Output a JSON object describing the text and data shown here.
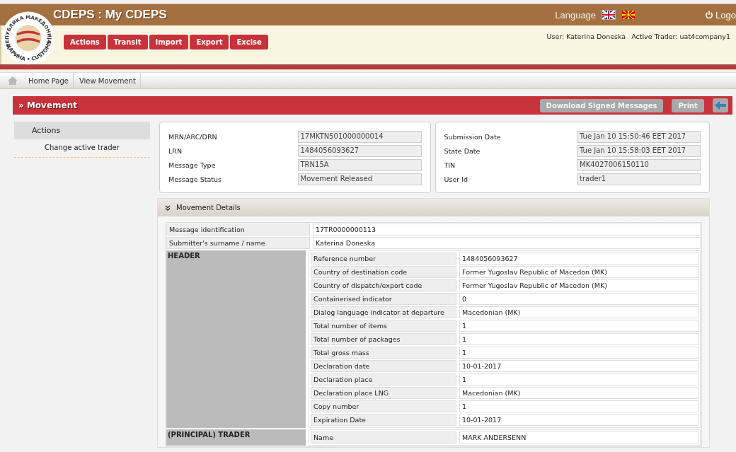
{
  "header": {
    "title": "CDEPS : My CDEPS",
    "logo_text": [
      "РЕПУБЛИКА МАКЕДОНИЈА",
      "ЦАРИНА • CUSTOMS"
    ],
    "language_label": "Language",
    "languages": [
      {
        "kind": "uk",
        "selected": true
      },
      {
        "kind": "mk",
        "selected": false
      }
    ],
    "logout": "Logo",
    "user": "User: Katerina Doneska",
    "active_trader": "Active Trader: uat4company1"
  },
  "nav": [
    "Actions",
    "Transit",
    "Import",
    "Export",
    "Excise"
  ],
  "breadcrumb": [
    "Home Page",
    "View Movement"
  ],
  "page_title": "» Movement",
  "toolbar": [
    "Download Signed Messages",
    "Print"
  ],
  "sidebar": {
    "heading": "Actions",
    "items": [
      "Change active trader"
    ]
  },
  "summary_left": [
    {
      "label": "MRN/ARC/DRN",
      "value": "17MKTN501000000014"
    },
    {
      "label": "LRN",
      "value": "1484056093627"
    },
    {
      "label": "Message Type",
      "value": "TRN15A"
    },
    {
      "label": "Message Status",
      "value": "Movement Released"
    }
  ],
  "summary_right": [
    {
      "label": "Submission Date",
      "value": "Tue Jan 10 15:50:46 EET 2017"
    },
    {
      "label": "State Date",
      "value": "Tue Jan 10 15:58:03 EET 2017"
    },
    {
      "label": "TIN",
      "value": "MK4027006150110"
    },
    {
      "label": "User Id",
      "value": "trader1"
    }
  ],
  "details": {
    "title": "Movement Details",
    "expanded": true,
    "rows": [
      {
        "label": "Message identification",
        "value": "17TR0000000113"
      },
      {
        "label": "Submitter's surname / name",
        "value": "Katerina Doneska"
      }
    ],
    "sections": [
      {
        "title": "HEADER",
        "rows": [
          {
            "label": "Reference number",
            "value": "1484056093627"
          },
          {
            "label": "Country of destination code",
            "value": "Former Yugoslav Republic of Macedon (MK)"
          },
          {
            "label": "Country of dispatch/export code",
            "value": "Former Yugoslav Republic of Macedon (MK)"
          },
          {
            "label": "Containerised indicator",
            "value": "0"
          },
          {
            "label": "Dialog language indicator at departure",
            "value": "Macedonian (MK)"
          },
          {
            "label": "Total number of items",
            "value": "1"
          },
          {
            "label": "Total number of packages",
            "value": "1"
          },
          {
            "label": "Total gross mass",
            "value": "1"
          },
          {
            "label": "Declaration date",
            "value": "10-01-2017"
          },
          {
            "label": "Declaration place",
            "value": "1"
          },
          {
            "label": "Declaration place LNG",
            "value": "Macedonian (MK)"
          },
          {
            "label": "Copy number",
            "value": "1"
          },
          {
            "label": "Expiration Date",
            "value": "10-01-2017"
          }
        ]
      },
      {
        "title": "(PRINCIPAL) TRADER",
        "rows": [
          {
            "label": "Name",
            "value": "MARK ANDERSENN"
          }
        ]
      }
    ]
  }
}
